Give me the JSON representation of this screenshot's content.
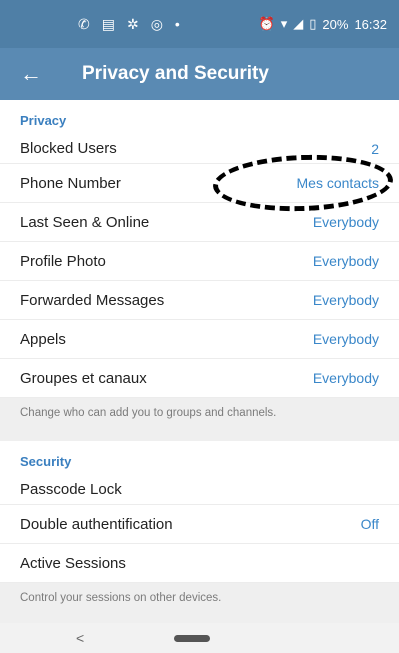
{
  "status_bar": {
    "time": "16:32",
    "battery": "20%",
    "icons": [
      "whatsapp-icon",
      "message-icon",
      "fan-icon",
      "instagram-icon",
      "dot-icon",
      "alarm-icon",
      "wifi-icon",
      "signal-icon",
      "battery-icon"
    ]
  },
  "app_bar": {
    "title": "Privacy and Security",
    "back_glyph": "←"
  },
  "privacy": {
    "header": "Privacy",
    "rows": [
      {
        "label": "Blocked Users",
        "value": "2"
      },
      {
        "label": "Phone Number",
        "value": "Mes contacts"
      },
      {
        "label": "Last Seen & Online",
        "value": "Everybody"
      },
      {
        "label": "Profile Photo",
        "value": "Everybody"
      },
      {
        "label": "Forwarded Messages",
        "value": "Everybody"
      },
      {
        "label": "Appels",
        "value": "Everybody"
      },
      {
        "label": "Groupes et canaux",
        "value": "Everybody"
      }
    ],
    "footer": "Change who can add you to groups and channels."
  },
  "security": {
    "header": "Security",
    "rows": [
      {
        "label": "Passcode Lock",
        "value": ""
      },
      {
        "label": "Double authentification",
        "value": "Off"
      },
      {
        "label": "Active Sessions",
        "value": ""
      }
    ],
    "footer": "Control your sessions on other devices."
  },
  "nav": {
    "back_glyph": "<"
  },
  "colors": {
    "status_bar": "#4f7fa6",
    "app_bar": "#5a8ab3",
    "accent": "#3a87c9",
    "highlight": "#000000"
  }
}
